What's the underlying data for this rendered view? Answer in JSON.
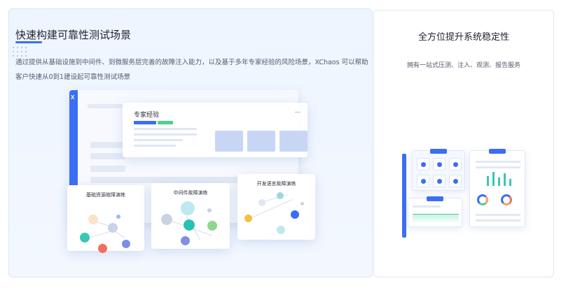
{
  "left_card": {
    "title": "快速构建可靠性测试场景",
    "description": "通过提供从基础设施到中间件、到微服务层完善的故障注入能力，以及基于多年专家经验的风险场景，XChaos 可以帮助客户快速从0到1建设起可靠性测试场景",
    "illustration": {
      "logo_glyph": "X",
      "expert_panel_title": "专家经验",
      "panels": [
        {
          "title": "基础资源故障演练"
        },
        {
          "title": "中间件故障演练"
        },
        {
          "title": "开发语言故障演练"
        }
      ]
    }
  },
  "right_card": {
    "title": "全方位提升系统稳定性",
    "description": "拥有一站式压测、注入、观测、报告服务"
  },
  "colors": {
    "accent": "#3b6ef5",
    "green": "#4fcf8f",
    "orange": "#f3a16a",
    "red": "#ef6f5f",
    "teal": "#39c7b7",
    "purple": "#8f8de8"
  }
}
